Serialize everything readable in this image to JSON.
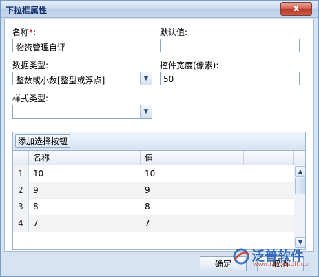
{
  "window": {
    "title": "下拉框属性",
    "close_symbol": "x"
  },
  "form": {
    "name_label": "名称",
    "required_mark": "*",
    "name_label_colon": ":",
    "name_value": "物资管理自评",
    "default_label": "默认值:",
    "default_value": "",
    "datatype_label": "数据类型:",
    "datatype_value": "整数或小数[整型或浮点]",
    "width_label": "控件宽度(像素):",
    "width_value": "50",
    "style_label": "样式类型:",
    "style_value": ""
  },
  "options_panel": {
    "add_button": "添加选择按钮",
    "columns": [
      "名称",
      "值"
    ],
    "rows": [
      {
        "num": "1",
        "name": "10",
        "value": "10"
      },
      {
        "num": "2",
        "name": "9",
        "value": "9"
      },
      {
        "num": "3",
        "name": "8",
        "value": "8"
      },
      {
        "num": "4",
        "name": "7",
        "value": "7"
      }
    ]
  },
  "footer": {
    "ok_label": "确定",
    "cancel_label": "取消"
  },
  "watermark": {
    "brand": "泛普软件",
    "url": "www.fanpusoft.com"
  },
  "colors": {
    "title_text": "#15316b",
    "close_button": "#c85a45",
    "required": "#d00000",
    "watermark": "#1c57b0"
  },
  "icons": {
    "close": "close-icon",
    "combo_arrow": "chevron-down-icon",
    "scroll_up": "scroll-up-icon",
    "scroll_down": "scroll-down-icon"
  }
}
